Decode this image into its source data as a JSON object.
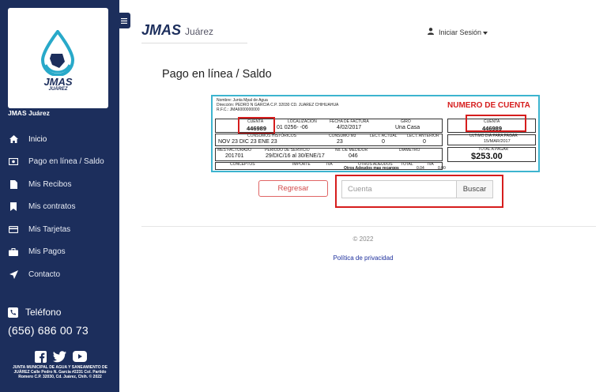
{
  "sidebar": {
    "logo_text": "JMAS",
    "logo_sub": "JUÁREZ",
    "title": "JMAS Juárez",
    "items": [
      {
        "label": "Inicio",
        "icon": "home-icon"
      },
      {
        "label": "Pago en línea / Saldo",
        "icon": "money-icon"
      },
      {
        "label": "Mis Recibos",
        "icon": "file-icon"
      },
      {
        "label": "Mis contratos",
        "icon": "bookmark-icon"
      },
      {
        "label": "Mis Tarjetas",
        "icon": "credit-card-icon"
      },
      {
        "label": "Mis Pagos",
        "icon": "briefcase-icon"
      },
      {
        "label": "Contacto",
        "icon": "send-icon"
      }
    ],
    "phone_label": "Teléfono",
    "phone_number": "(656) 686 00 73",
    "footer": "JUNTA MUNICIPAL DE AGUA Y SANEAMIENTO DE JUÁREZ Calle Pedro N. García #2231 Col. Partido Romero C.P. 32030, Cd. Juárez, Chih. © 2022"
  },
  "header": {
    "brand": "JMAS",
    "brand_sub": "Juárez",
    "login": "Iniciar Sesión"
  },
  "main": {
    "title": "Pago en línea / Saldo",
    "receipt": {
      "annotation": "NUMERO DE CUENTA",
      "name_line": "Nombre:  Junta Mpal de Agua",
      "address_line": "Dirección:  PEDRO N GARCIA C.P. 32030    CD. JUAREZ CHIHUAHUA",
      "rfc_line": "R.F.C.:   JMA6000000000",
      "cuenta_label": "CUENTA",
      "cuenta_value": "446989",
      "localizacion_label": "LOCALIZACION",
      "localizacion_value": "01    0256-    -06",
      "fecha_label": "FECHA DE FACTURA",
      "fecha_value": "4/02/2017",
      "giro_label": "GIRO",
      "giro_value": "Una Casa",
      "consumos_label": "CONSUMOS HISTÓRICOS",
      "consumos_value": "NOV  23    DIC  23    ENE  23",
      "consumo_m3_label": "CONSUMO M3",
      "consumo_m3_value": "23",
      "lect_actual_label": "LECT. ACTUAL",
      "lect_actual_value": "0",
      "lect_anterior_label": "LECT. ANTERIOR",
      "lect_anterior_value": "0",
      "mes_label": "MES FACTURADO",
      "mes_value": "201701",
      "periodo_label": "PERIODO DE SERVICIO",
      "periodo_value": "29/DIC/16 al 30/ENE/17",
      "medidor_label": "No. DE MEDIDOR",
      "medidor_value": "046",
      "diametro_label": "DIAMETRO",
      "conceptos_label": "CONCEPTOS",
      "importe_label": "IMPORTE",
      "iva_label": "IVA",
      "otros_label": "OTROS ADEUDOS",
      "total_label": "TOTAL",
      "iva2_label": "IVA",
      "otros_adeudos_line": "Otros Adeudos mas recargos",
      "otros_val1": "0.04",
      "otros_val2": "0.00",
      "right_cuenta_label": "CUENTA",
      "right_cuenta_value": "446989",
      "ultimo_label": "ULTIMO DIA PARA PAGAR",
      "ultimo_value": "15/MAR/2017",
      "total_pagar_label": "TOTAL A PAGAR",
      "total_pagar_value": "$253.00"
    },
    "back_button": "Regresar",
    "search_placeholder": "Cuenta",
    "search_button": "Buscar"
  },
  "footer": {
    "copyright": "© 2022",
    "privacy": "Política de privacidad"
  },
  "colors": {
    "sidebar": "#1c2e5c",
    "highlight": "#d61d1d",
    "receipt_border": "#3db4cf"
  }
}
